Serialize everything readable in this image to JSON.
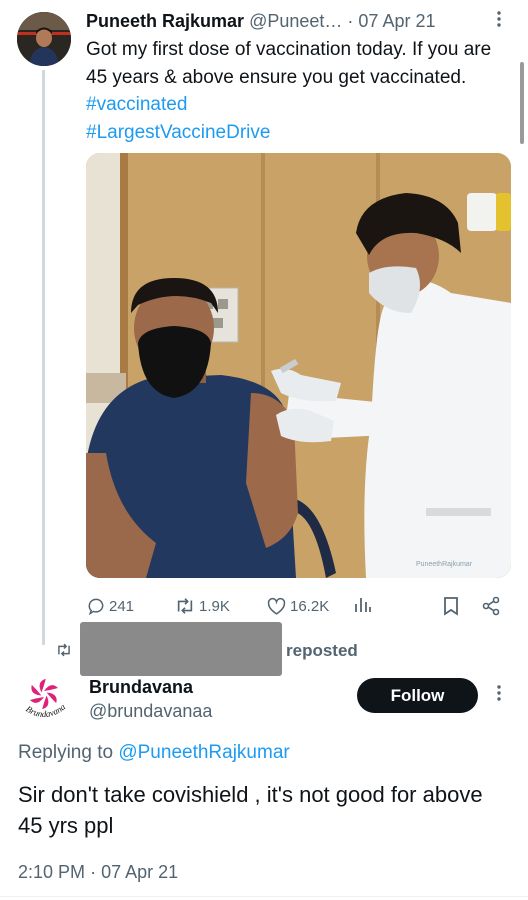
{
  "post": {
    "author_name": "Puneeth Rajkumar",
    "author_handle": "@Puneet…",
    "separator": "·",
    "date": "07 Apr 21",
    "text": "Got my first dose of vaccination today. If you are 45 years & above ensure you get vaccinated.",
    "hashtags": [
      "#vaccinated",
      "#LargestVaccineDrive"
    ],
    "image_watermark": "PuneethRajkumar",
    "stats": {
      "replies": "241",
      "reposts": "1.9K",
      "likes": "16.2K"
    }
  },
  "repost": {
    "label": "reposted"
  },
  "reply": {
    "author_name": "Brundavana",
    "author_handle": "@brundavanaa",
    "avatar_text": "Brundavana",
    "follow_label": "Follow",
    "replying_prefix": "Replying to",
    "replying_to": "@PuneethRajkumar",
    "text": "Sir don't take covishield , it's not good for above 45 yrs ppl",
    "timestamp": "2:10 PM",
    "separator": "·",
    "date": "07 Apr 21"
  },
  "colors": {
    "link": "#1d9bf0",
    "text": "#0f1419",
    "secondary": "#536471",
    "follow_bg": "#0f1419",
    "brand_pink": "#e0217a"
  },
  "icons": [
    "more-icon",
    "reply-icon",
    "repost-icon",
    "like-icon",
    "views-icon",
    "bookmark-icon",
    "share-icon"
  ]
}
